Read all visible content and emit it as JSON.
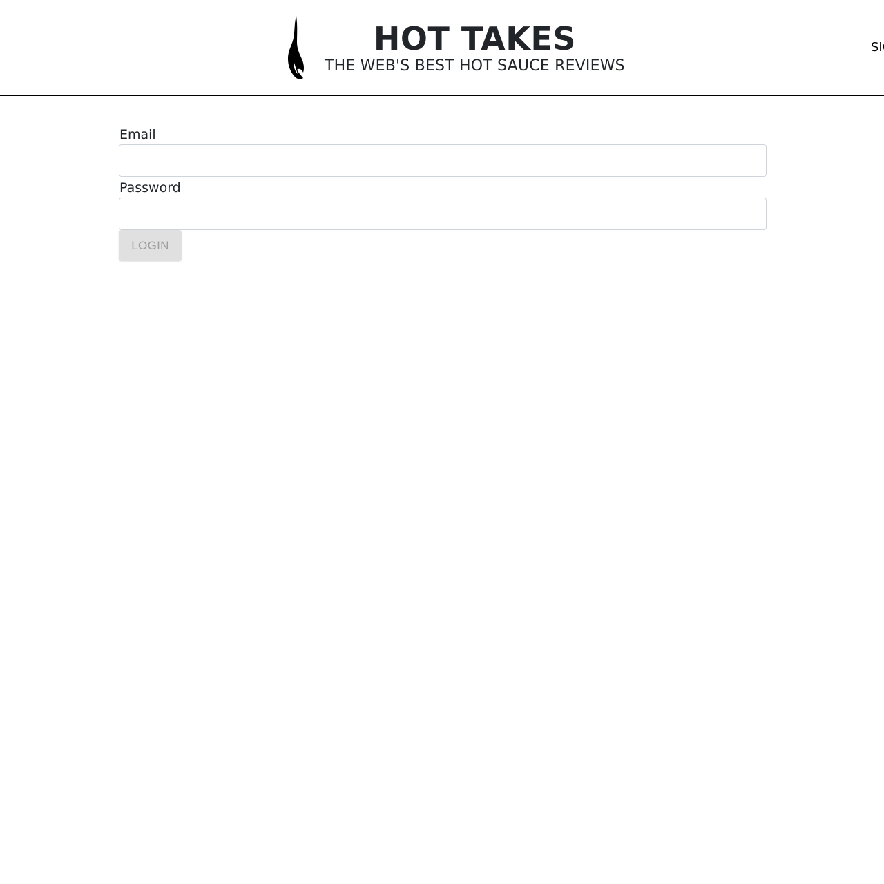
{
  "header": {
    "title": "HOT TAKES",
    "tagline": "THE WEB'S BEST HOT SAUCE REVIEWS",
    "logo_icon": "flame-icon",
    "nav": {
      "signup_label": "SIGNUP"
    }
  },
  "form": {
    "email_label": "Email",
    "email_value": "",
    "password_label": "Password",
    "password_value": "",
    "login_label": "LOGIN"
  },
  "colors": {
    "text": "#212529",
    "divider": "#000000",
    "input_border": "#ced4da",
    "button_disabled_bg": "#e0e0e0",
    "button_disabled_text": "#9e9e9e"
  }
}
